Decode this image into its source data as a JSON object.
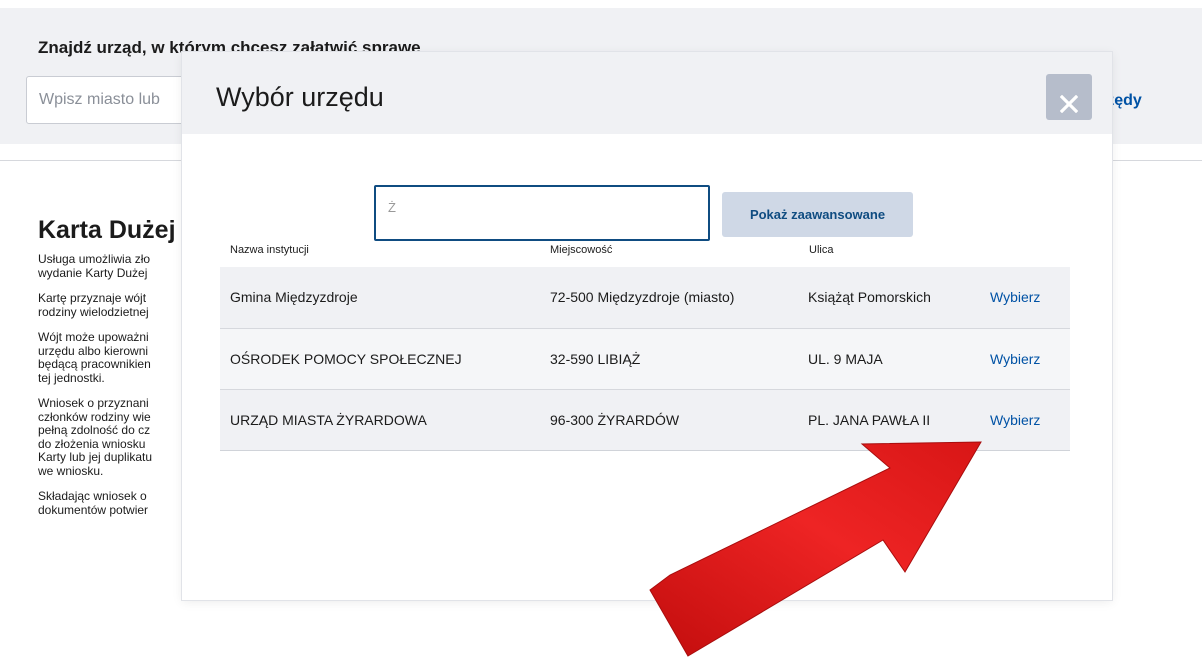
{
  "finder": {
    "title": "Znajdź urząd, w którym chcesz załatwić sprawę",
    "input_placeholder": "Wpisz miasto lub",
    "link_label": "rzędy"
  },
  "article": {
    "title": "Karta Dużej",
    "paragraphs": [
      "Usługa umożliwia zło\nwydanie Karty Dużej",
      "Kartę przyznaje wójt\nrodziny wielodzietnej",
      "Wójt może upoważni\nurzędu albo kierowni\nbędącą pracownikien\ntej jednostki.",
      "Wniosek o przyznani\nczłonków rodziny wie\npełną zdolność do cz\ndo złożenia wniosku\nKarty lub jej duplikatu\nwe wniosku.",
      "Składając wniosek o\ndokumentów potwier"
    ]
  },
  "modal": {
    "title": "Wybór urzędu",
    "close_icon": "close-icon",
    "search_value": "Ż",
    "advanced_button": "Pokaż zaawansowane",
    "columns": {
      "name": "Nazwa instytucji",
      "city": "Miejscowość",
      "street": "Ulica"
    },
    "rows": [
      {
        "name": "Gmina Międzyzdroje",
        "city": "72-500 Międzyzdroje (miasto)",
        "street": "Książąt Pomorskich",
        "action": "Wybierz"
      },
      {
        "name": "OŚRODEK POMOCY SPOŁECZNEJ",
        "city": "32-590 LIBIĄŻ",
        "street": "UL. 9 MAJA",
        "action": "Wybierz"
      },
      {
        "name": "URZĄD MIASTA ŻYRARDOWA",
        "city": "96-300 ŻYRARDÓW",
        "street": "PL. JANA PAWŁA II",
        "action": "Wybierz"
      }
    ]
  },
  "colors": {
    "accent": "#0052a5",
    "arrow": "#e21b1b"
  }
}
